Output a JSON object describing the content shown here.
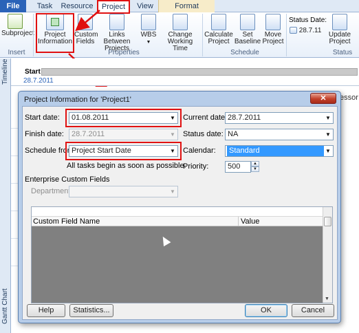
{
  "ribbon": {
    "tabs": [
      {
        "id": "file",
        "label": "File"
      },
      {
        "id": "task",
        "label": "Task"
      },
      {
        "id": "resource",
        "label": "Resource"
      },
      {
        "id": "project",
        "label": "Project"
      },
      {
        "id": "view",
        "label": "View"
      },
      {
        "id": "format",
        "label": "Format"
      }
    ],
    "buttons": {
      "subproject": "Subproject",
      "project_information_1": "Project",
      "project_information_2": "Information",
      "custom_fields_1": "Custom",
      "custom_fields_2": "Fields",
      "links_between_projects_1": "Links Between",
      "links_between_projects_2": "Projects",
      "wbs": "WBS",
      "change_working_time_1": "Change",
      "change_working_time_2": "Working Time",
      "calculate_project_1": "Calculate",
      "calculate_project_2": "Project",
      "set_baseline_1": "Set",
      "set_baseline_2": "Baseline",
      "move_project_1": "Move",
      "move_project_2": "Project",
      "status_date_label": "Status Date:",
      "status_date_value": "28.7.11",
      "update_project_1": "Update",
      "update_project_2": "Project"
    },
    "groups": {
      "insert": "Insert",
      "properties": "Properties",
      "schedule": "Schedule",
      "status": "Status"
    }
  },
  "timeline": {
    "side_label": "Timeline",
    "start_label": "Start",
    "start_date": "28.7.2011"
  },
  "gantt": {
    "side_label": "Gantt Chart",
    "partial_header": "essor"
  },
  "dialog": {
    "title": "Project Information for 'Project1'",
    "close": "✕",
    "start_date_label": "Start date:",
    "start_date_value": "01.08.2011",
    "finish_date_label": "Finish date:",
    "finish_date_value": "28.7.2011",
    "schedule_from_label": "Schedule from:",
    "schedule_from_value": "Project Start Date",
    "schedule_note": "All tasks begin as soon as possible.",
    "current_date_label": "Current date:",
    "current_date_value": "28.7.2011",
    "status_date_label": "Status date:",
    "status_date_value": "NA",
    "calendar_label": "Calendar:",
    "calendar_value": "Standard",
    "priority_label": "Priority:",
    "priority_value": "500",
    "enterprise_label": "Enterprise Custom Fields",
    "department_label": "Department:",
    "department_value": "",
    "grid_columns": [
      "Custom Field Name",
      "Value"
    ],
    "help_button": "Help",
    "statistics_button": "Statistics...",
    "ok_button": "OK",
    "cancel_button": "Cancel"
  },
  "colors": {
    "highlight": "#e01010",
    "accent": "#2a63b8",
    "selection": "#3399ff"
  }
}
